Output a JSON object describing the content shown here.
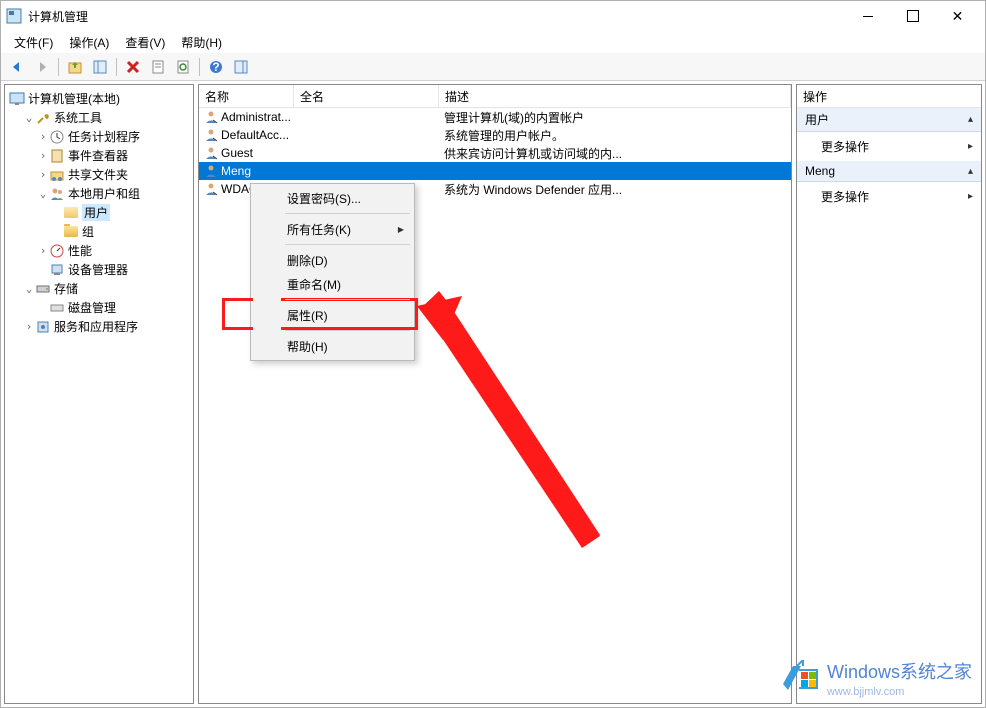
{
  "titlebar": {
    "text": "计算机管理"
  },
  "menu": {
    "file": "文件(F)",
    "action": "操作(A)",
    "view": "查看(V)",
    "help": "帮助(H)"
  },
  "tree": {
    "root": "计算机管理(本地)",
    "system_tools": "系统工具",
    "task_scheduler": "任务计划程序",
    "event_viewer": "事件查看器",
    "shared_folders": "共享文件夹",
    "local_users_groups": "本地用户和组",
    "users": "用户",
    "groups": "组",
    "performance": "性能",
    "device_manager": "设备管理器",
    "storage": "存储",
    "disk_management": "磁盘管理",
    "services_apps": "服务和应用程序"
  },
  "list": {
    "col_name": "名称",
    "col_fullname": "全名",
    "col_desc": "描述",
    "rows": [
      {
        "name": "Administrat...",
        "fullname": "",
        "desc": "管理计算机(域)的内置帐户"
      },
      {
        "name": "DefaultAcc...",
        "fullname": "",
        "desc": "系统管理的用户帐户。"
      },
      {
        "name": "Guest",
        "fullname": "",
        "desc": "供来宾访问计算机或访问域的内..."
      },
      {
        "name": "Meng",
        "fullname": "",
        "desc": ""
      },
      {
        "name": "WDAG",
        "fullname": "",
        "desc": "系统为 Windows Defender 应用..."
      }
    ]
  },
  "actions": {
    "header": "操作",
    "group1": "用户",
    "group2": "Meng",
    "more": "更多操作"
  },
  "context": {
    "set_password": "设置密码(S)...",
    "all_tasks": "所有任务(K)",
    "delete": "删除(D)",
    "rename": "重命名(M)",
    "properties": "属性(R)",
    "help": "帮助(H)"
  },
  "watermark": {
    "main": "Windows系统之家",
    "sub": "www.bjjmlv.com"
  }
}
